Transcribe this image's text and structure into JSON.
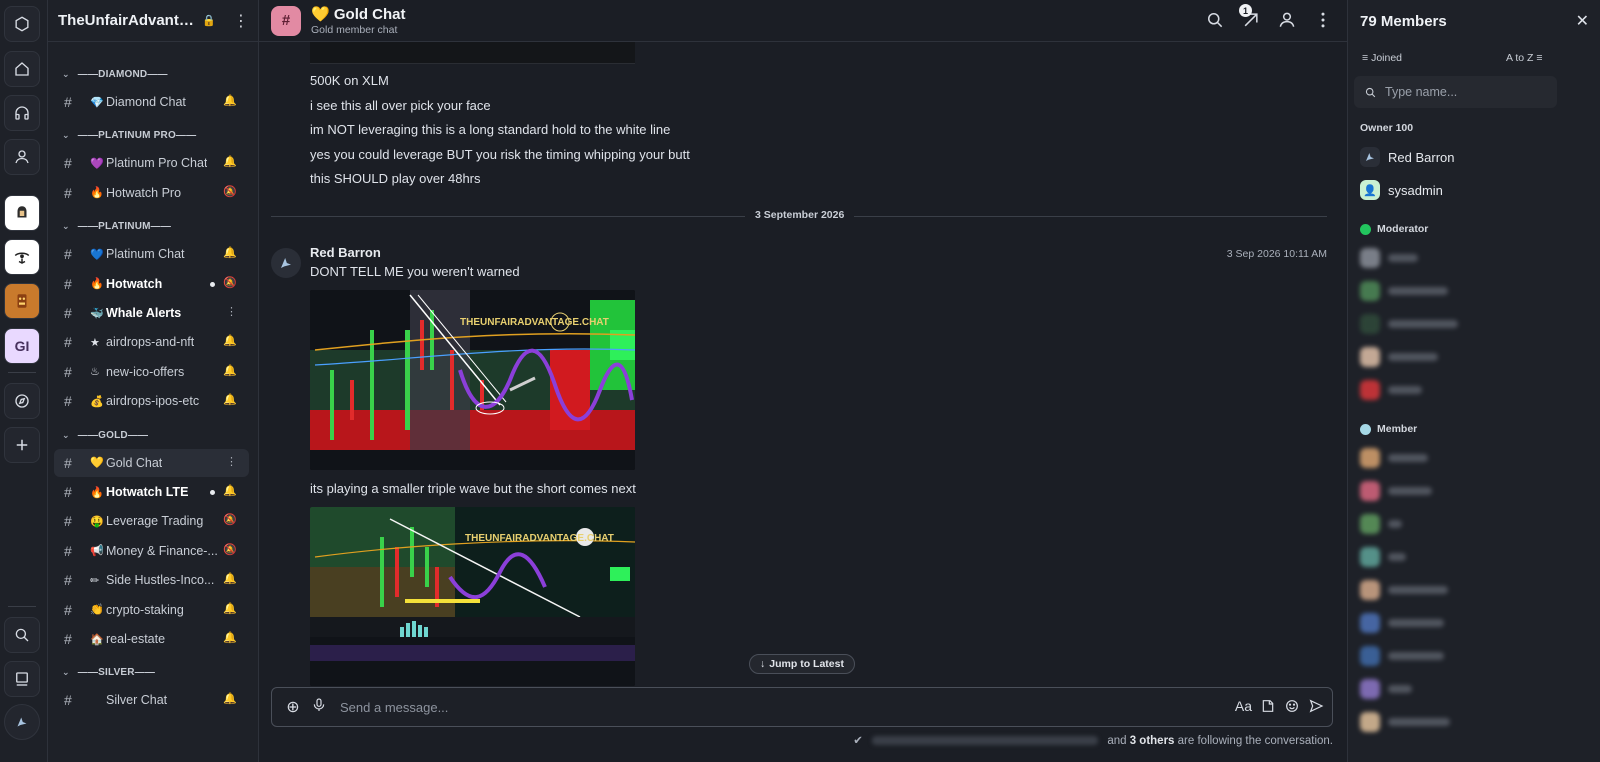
{
  "workspace": {
    "name": "TheUnfairAdvantage.chat",
    "server_badge": "GI"
  },
  "sidebar": {
    "categories": [
      {
        "label": "——DIAMOND——",
        "rooms": [
          {
            "icon": "💎",
            "name": "Diamond Chat",
            "bold": false,
            "unread": false,
            "tail": "bell-sync"
          }
        ]
      },
      {
        "label": "——PLATINUM PRO——",
        "rooms": [
          {
            "icon": "💜",
            "name": "Platinum Pro Chat",
            "bold": false,
            "unread": false,
            "tail": "bell-sync"
          },
          {
            "icon": "🔥",
            "name": "Hotwatch Pro",
            "bold": false,
            "unread": false,
            "tail": "bell-muted"
          }
        ]
      },
      {
        "label": "——PLATINUM——",
        "rooms": [
          {
            "icon": "💙",
            "name": "Platinum Chat",
            "bold": false,
            "unread": false,
            "tail": "bell-sync"
          },
          {
            "icon": "🔥",
            "name": "Hotwatch",
            "bold": true,
            "unread": true,
            "tail": "bell-muted"
          },
          {
            "icon": "🐳",
            "name": "Whale Alerts",
            "bold": true,
            "unread": false,
            "tail": "more"
          },
          {
            "icon": "★",
            "name": "airdrops-and-nft",
            "bold": false,
            "unread": false,
            "tail": "bell-sync"
          },
          {
            "icon": "♨",
            "name": "new-ico-offers",
            "bold": false,
            "unread": false,
            "tail": "bell-sync"
          },
          {
            "icon": "💰",
            "name": "airdrops-ipos-etc",
            "bold": false,
            "unread": false,
            "tail": "bell-sync"
          }
        ]
      },
      {
        "label": "——GOLD——",
        "rooms": [
          {
            "icon": "💛",
            "name": "Gold Chat",
            "bold": false,
            "unread": false,
            "tail": "more",
            "active": true
          },
          {
            "icon": "🔥",
            "name": "Hotwatch LTE",
            "bold": true,
            "unread": true,
            "tail": "bell-sync"
          },
          {
            "icon": "🤑",
            "name": "Leverage Trading",
            "bold": false,
            "unread": false,
            "tail": "bell-muted"
          },
          {
            "icon": "📢",
            "name": "Money & Finance-...",
            "bold": false,
            "unread": false,
            "tail": "bell-muted"
          },
          {
            "icon": "✏",
            "name": "Side Hustles-Inco...",
            "bold": false,
            "unread": false,
            "tail": "bell-sync"
          },
          {
            "icon": "👏",
            "name": "crypto-staking",
            "bold": false,
            "unread": false,
            "tail": "bell-sync"
          },
          {
            "icon": "🏠",
            "name": "real-estate",
            "bold": false,
            "unread": false,
            "tail": "bell-sync"
          }
        ]
      },
      {
        "label": "——SILVER——",
        "rooms": [
          {
            "icon": "",
            "name": "Silver Chat",
            "bold": false,
            "unread": false,
            "tail": "bell-sync"
          }
        ]
      }
    ]
  },
  "channel": {
    "emoji": "💛",
    "title": "Gold Chat",
    "subtitle": "Gold member chat",
    "notification_count": "1"
  },
  "timeline": {
    "earlier_lines": [
      "500K on XLM",
      "i see this all over pick your face",
      "im NOT leveraging this is a long standard hold to the white line",
      "yes you could leverage BUT you risk the timing whipping your butt",
      "this SHOULD play over 48hrs"
    ],
    "date_divider": "3 September 2026",
    "message": {
      "sender": "Red Barron",
      "timestamp": "3 Sep 2026 10:11 AM",
      "text1": "DONT TELL ME you weren't warned",
      "image1_watermark": "THEUNFAIRADVANTAGE.CHAT",
      "text2": "its playing a smaller triple wave but the short comes next",
      "image2_watermark": "THEUNFAIRADVANTAGE.CHAT"
    },
    "jump_label": "Jump to Latest"
  },
  "composer": {
    "placeholder": "Send a message...",
    "format_label": "Aa"
  },
  "following": {
    "and_text": "and",
    "others": "3 others",
    "suffix": "are following the conversation."
  },
  "members": {
    "title": "79 Members",
    "filter_label": "Joined",
    "sort_label": "A to Z",
    "search_placeholder": "Type name...",
    "owner_group": "Owner 100",
    "owners": [
      {
        "name": "Red Barron",
        "avatar_bg": "#2a2e37"
      },
      {
        "name": "sysadmin",
        "avatar_bg": "#c9f1d2"
      }
    ],
    "moderator_group": "Moderator",
    "member_group": "Member",
    "colors": {
      "moderator": "#22c55e",
      "member": "#a5d8e6"
    }
  }
}
